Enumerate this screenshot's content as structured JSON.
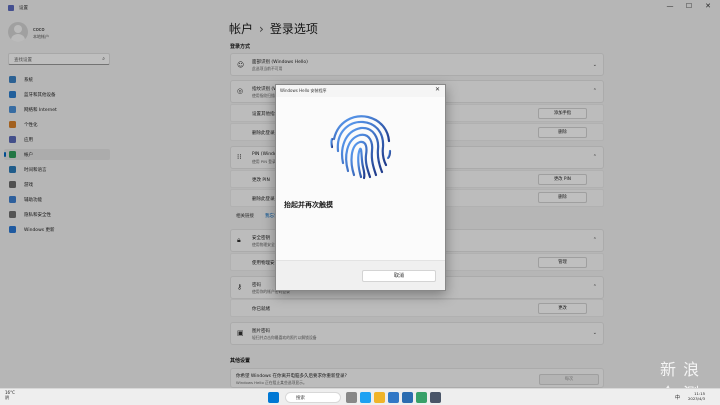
{
  "window": {
    "title": "设置",
    "controls": {
      "min": "—",
      "max": "☐",
      "close": "✕"
    }
  },
  "user": {
    "name": "coco",
    "type": "本地帐户"
  },
  "search": {
    "placeholder": "查找设置"
  },
  "nav": [
    {
      "label": "系统",
      "color": "#3b82c4"
    },
    {
      "label": "蓝牙和其他设备",
      "color": "#2d7fcf"
    },
    {
      "label": "网络和 Internet",
      "color": "#4a90d9"
    },
    {
      "label": "个性化",
      "color": "#d9822b"
    },
    {
      "label": "应用",
      "color": "#5a6ab8"
    },
    {
      "label": "帐户",
      "color": "#2e9e5b",
      "active": true
    },
    {
      "label": "时间和语言",
      "color": "#2b7bb9"
    },
    {
      "label": "游戏",
      "color": "#6b6b6b"
    },
    {
      "label": "辅助功能",
      "color": "#3c7fd0"
    },
    {
      "label": "隐私和安全性",
      "color": "#707070"
    },
    {
      "label": "Windows 更新",
      "color": "#2a79d6"
    }
  ],
  "breadcrumb": {
    "parent": "帐户",
    "sep": "›",
    "current": "登录选项"
  },
  "sections": {
    "login_methods": "登录方式",
    "additional": "其他设置"
  },
  "cards": {
    "face": {
      "title": "面部识别 (Windows Hello)",
      "sub": "此选项当前不可用"
    },
    "finger": {
      "title": "指纹识别 (Windows Hello)",
      "sub": "使用指纹扫描器登录 (推荐)"
    },
    "finger_setup": {
      "label": "设置其他指纹",
      "button": "添加手指"
    },
    "finger_remove": {
      "label": "删除此登录选项",
      "button": "删除"
    },
    "pin": {
      "title": "PIN (Windows Hello)",
      "sub": "使用 PIN 登录 (推荐)"
    },
    "pin_change": {
      "label": "更改 PIN",
      "button": "更改 PIN"
    },
    "pin_remove": {
      "label": "删除此登录选项",
      "button": "删除"
    },
    "related": {
      "label": "相关链接",
      "link": "我忘记了我的 PIN"
    },
    "key": {
      "title": "安全密钥",
      "sub": "使用物理安全密钥登录"
    },
    "key_manage": {
      "label": "使用物理安全密钥登录应用",
      "button": "管理"
    },
    "password": {
      "title": "密码",
      "sub": "使用你的帐户密码登录"
    },
    "pw_change": {
      "label": "你已就绪",
      "button": "更改"
    },
    "picture": {
      "title": "图片密码",
      "sub": "轻扫并点击你最喜欢的照片以解锁设备"
    },
    "away": {
      "title": "你希望 Windows 在你离开电脑多久后要求你重新登录?",
      "sub": "Windows Hello 正在阻止某些选项显示。",
      "value": "每次"
    }
  },
  "dialog": {
    "title": "Windows Hello 安装程序",
    "message": "抬起并再次触摸",
    "cancel": "取消",
    "close": "✕"
  },
  "taskbar": {
    "temp": "16°C",
    "weather": "阴",
    "search": "搜索",
    "time": "11:15",
    "date": "2023/4/3",
    "ime": "中"
  },
  "watermark": "新 浪 众 测",
  "colors": {
    "accent": "#0067c0",
    "fingerprint_a": "#1e3a8a",
    "fingerprint_b": "#60a5fa"
  }
}
